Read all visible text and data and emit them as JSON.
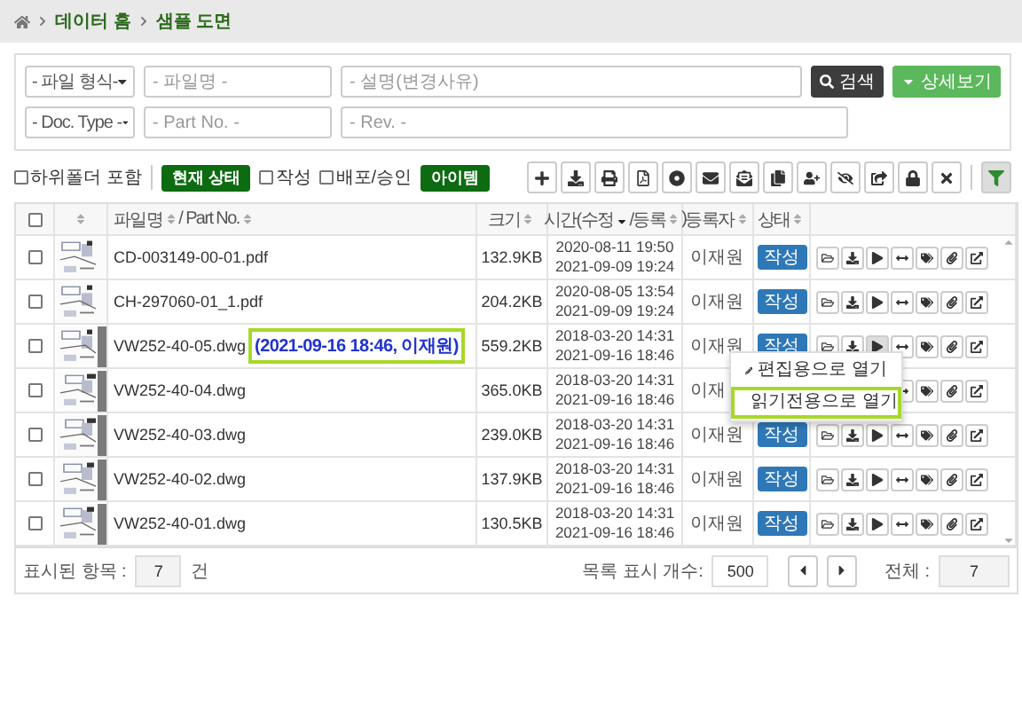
{
  "breadcrumb": [
    "데이터 홈",
    "샘플 도면"
  ],
  "search": {
    "rows": [
      [
        {
          "kind": "select",
          "value": "- 파일 형식-"
        },
        {
          "kind": "input",
          "placeholder": "- 파일명 -"
        },
        {
          "kind": "input",
          "placeholder": "- 설명(변경사유)"
        }
      ],
      [
        {
          "kind": "select",
          "value": "- Doc. Type -"
        },
        {
          "kind": "input",
          "placeholder": "- Part No. -"
        },
        {
          "kind": "input",
          "placeholder": "- Rev. -"
        }
      ]
    ],
    "search_button": "검색",
    "detail_button": "상세보기"
  },
  "options": [
    {
      "kind": "checkbox",
      "label": "하위폴더 포함",
      "checked": false
    },
    {
      "kind": "badge",
      "label": "현재 상태"
    },
    {
      "kind": "checkbox",
      "label": "작성",
      "checked": false
    },
    {
      "kind": "checkbox",
      "label": "배포/승인",
      "checked": false
    },
    {
      "kind": "badge",
      "label": "아이템"
    }
  ],
  "table": {
    "all_checked": false,
    "columns": [
      {
        "kind": "check"
      },
      {
        "kind": "thumb"
      },
      {
        "kind": "name",
        "parts": [
          {
            "text": "파일명",
            "sortable": true,
            "sorted": false
          },
          {
            "text": "/ Part No.",
            "sortable": true,
            "sorted": false
          }
        ]
      },
      {
        "kind": "size",
        "parts": [
          {
            "text": "크기",
            "sortable": true,
            "sorted": false
          }
        ]
      },
      {
        "kind": "time",
        "parts": [
          {
            "text": "시간(수정",
            "sortable": true,
            "sorted": true
          },
          {
            "text": "/등록",
            "sortable": true,
            "sorted": false
          },
          {
            "text": ")",
            "sortable": false
          }
        ]
      },
      {
        "kind": "user",
        "parts": [
          {
            "text": "등록자",
            "sortable": true,
            "sorted": false
          }
        ]
      },
      {
        "kind": "status",
        "parts": [
          {
            "text": "상태",
            "sortable": true,
            "sorted": false
          }
        ]
      },
      {
        "kind": "actions"
      }
    ],
    "rows": [
      {
        "checked": false,
        "thumb_bar": false,
        "name": "CD-003149-00-01.pdf",
        "size": "132.9KB",
        "time_1": "2020-08-11 19:50",
        "time_2": "2021-09-09 19:24",
        "user": "이재원",
        "status": "작성",
        "active": false
      },
      {
        "checked": false,
        "thumb_bar": false,
        "name": "CH-297060-01_1.pdf",
        "size": "204.2KB",
        "time_1": "2020-08-05 13:54",
        "time_2": "2021-09-09 19:24",
        "user": "이재원",
        "status": "작성",
        "active": false
      },
      {
        "checked": false,
        "thumb_bar": true,
        "name": "VW252-40-05.dwg",
        "note": "(2021-09-16 18:46, 이재원)",
        "size": "559.2KB",
        "time_1": "2018-03-20 14:31",
        "time_2": "2021-09-16 18:46",
        "user": "이재원",
        "status": "작성",
        "active": true
      },
      {
        "checked": false,
        "thumb_bar": true,
        "name": "VW252-40-04.dwg",
        "size": "365.0KB",
        "time_1": "2018-03-20 14:31",
        "time_2": "2021-09-16 18:46",
        "user": "이재",
        "active": false
      },
      {
        "checked": false,
        "thumb_bar": true,
        "name": "VW252-40-03.dwg",
        "size": "239.0KB",
        "time_1": "2018-03-20 14:31",
        "time_2": "2021-09-16 18:46",
        "user": "이재원",
        "status": "작성",
        "active": false
      },
      {
        "checked": false,
        "thumb_bar": true,
        "name": "VW252-40-02.dwg",
        "size": "137.9KB",
        "time_1": "2018-03-20 14:31",
        "time_2": "2021-09-16 18:46",
        "user": "이재원",
        "status": "작성",
        "active": false
      },
      {
        "checked": false,
        "thumb_bar": true,
        "name": "VW252-40-01.dwg",
        "size": "130.5KB",
        "time_1": "2018-03-20 14:31",
        "time_2": "2021-09-16 18:46",
        "user": "이재원",
        "status": "작성",
        "active": false
      }
    ]
  },
  "context_menu": {
    "items": [
      {
        "kind": "edit",
        "label": "편집용으로 열기",
        "highlighted": false
      },
      {
        "kind": "readonly",
        "label": "읽기전용으로 열기",
        "highlighted": true
      }
    ]
  },
  "footer": {
    "shown_label": "표시된 항목 :",
    "shown_count": "7",
    "shown_unit": "건",
    "page_size_label": "목록 표시 개수:",
    "page_size": "500",
    "total_label": "전체 :",
    "total": "7"
  }
}
